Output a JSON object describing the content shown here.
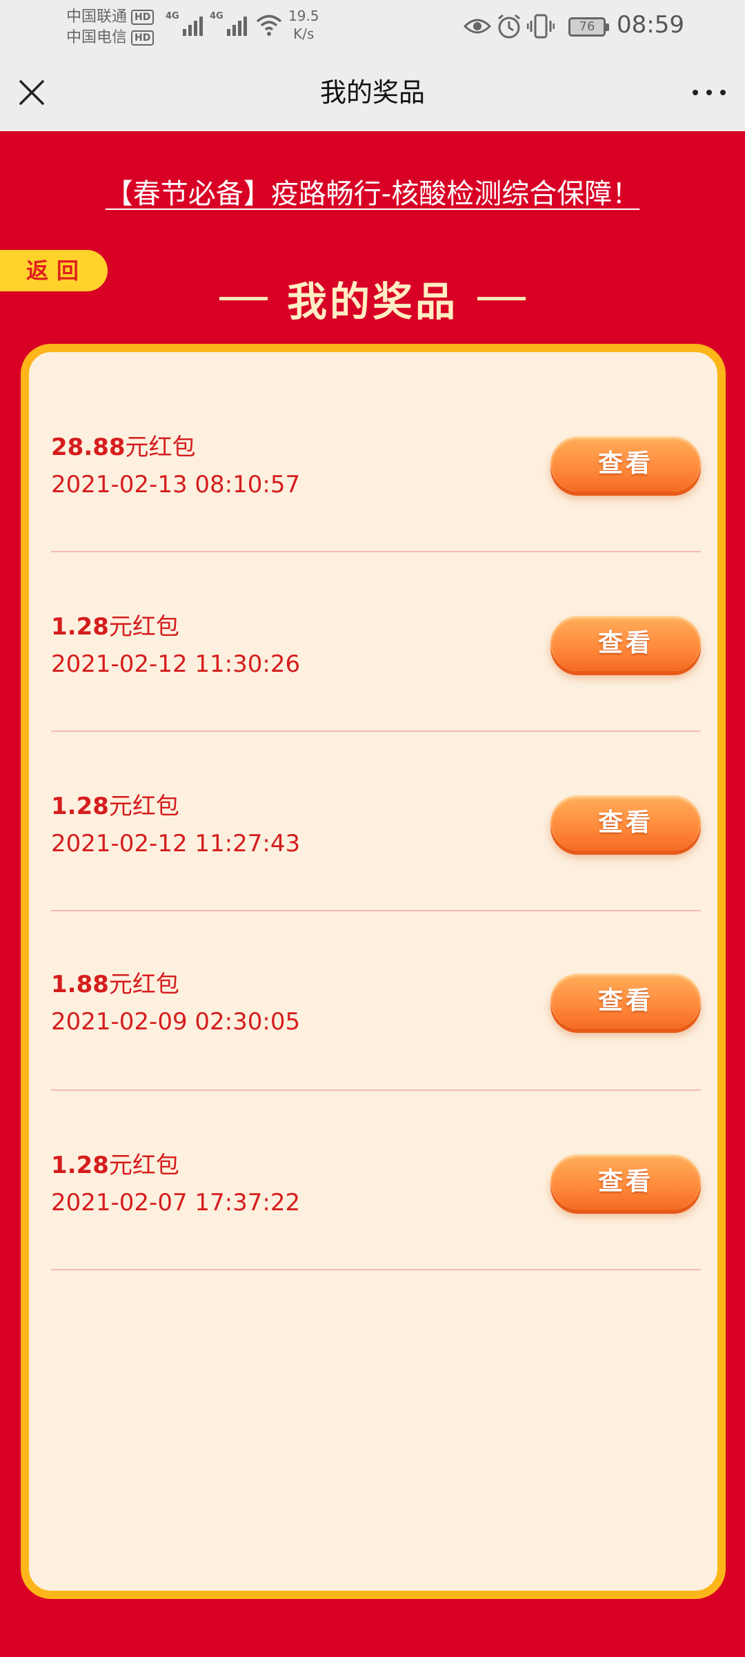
{
  "status_bar": {
    "carrier_1": "中国联通",
    "carrier_2": "中国电信",
    "hd_badge": "HD",
    "network_1": "4G",
    "network_2": "4G",
    "speed_value": "19.5",
    "speed_unit": "K/s",
    "battery": "76",
    "time": "08:59"
  },
  "nav": {
    "title": "我的奖品"
  },
  "banner": {
    "text": "【春节必备】疫路畅行-核酸检测综合保障！"
  },
  "back_button": {
    "label": "返回"
  },
  "section": {
    "heading": "我的奖品"
  },
  "prizes": [
    {
      "amount": "28.88",
      "suffix": "元红包",
      "time": "2021-02-13 08:10:57",
      "button": "查看"
    },
    {
      "amount": "1.28",
      "suffix": "元红包",
      "time": "2021-02-12 11:30:26",
      "button": "查看"
    },
    {
      "amount": "1.28",
      "suffix": "元红包",
      "time": "2021-02-12 11:27:43",
      "button": "查看"
    },
    {
      "amount": "1.88",
      "suffix": "元红包",
      "time": "2021-02-09 02:30:05",
      "button": "查看"
    },
    {
      "amount": "1.28",
      "suffix": "元红包",
      "time": "2021-02-07 17:37:22",
      "button": "查看"
    }
  ]
}
